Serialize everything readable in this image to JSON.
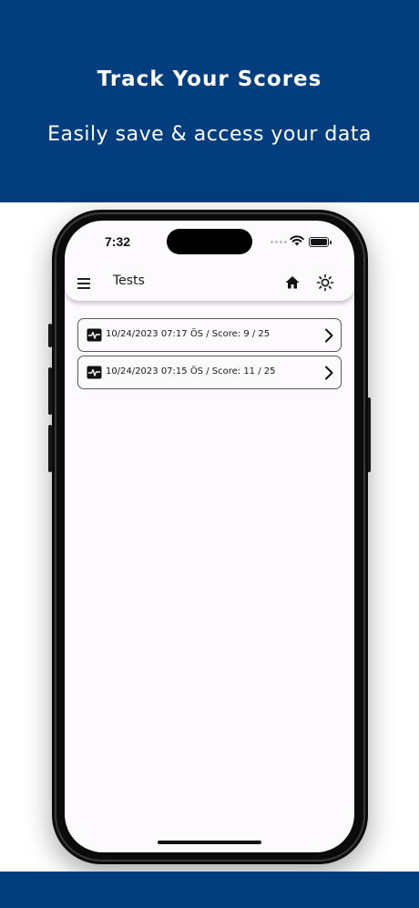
{
  "banner": {
    "title": "Track Your Scores",
    "subtitle": "Easily save & access your data"
  },
  "status_bar": {
    "time": "7:32",
    "icons": [
      "cellular-dots-icon",
      "wifi-icon",
      "battery-icon"
    ]
  },
  "app_bar": {
    "title": "Tests",
    "icons": [
      "menu-icon",
      "home-icon",
      "brightness-icon"
    ]
  },
  "tests": [
    {
      "label": "10/24/2023 07:17 ÖS  /  Score: 9 / 25",
      "icon": "pulse-icon"
    },
    {
      "label": "10/24/2023 07:15 ÖS  /  Score: 11 / 25",
      "icon": "pulse-icon"
    }
  ],
  "colors": {
    "banner_bg": "#023e7d",
    "screen_bg": "#fcfafc",
    "text": "#1a1a1a"
  }
}
